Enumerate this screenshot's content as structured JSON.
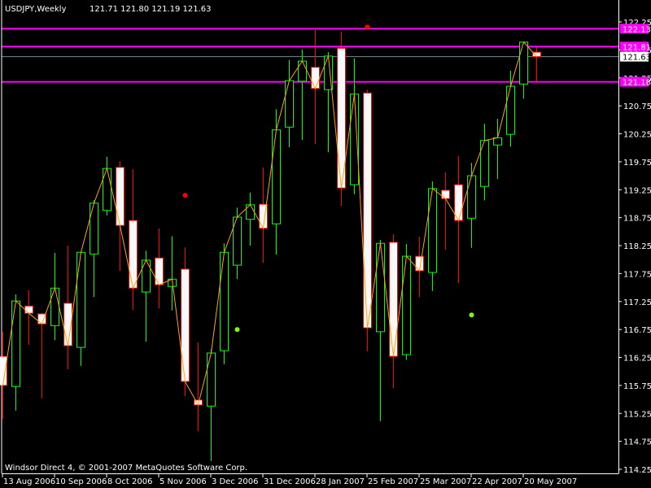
{
  "header": {
    "symbol_timeframe": "USDJPY,Weekly",
    "ohlc": "121.71 121.80 121.19 121.63"
  },
  "footer": {
    "copyright": "Windsor Direct 4, © 2001-2007 MetaQuotes Software Corp."
  },
  "colors": {
    "background": "#000000",
    "axis": "#ffffff",
    "bull_outline": "#00ff00",
    "bear_outline": "#ff0000",
    "bear_fill": "#f8f8f8",
    "close_line": "#ffa500",
    "level_line": "#ff00ff",
    "bid_line": "#778899",
    "marker_red": "#ff0000",
    "marker_green": "#7cfc00"
  },
  "chart_data": {
    "type": "candlestick",
    "title": "USDJPY,Weekly",
    "ylim": [
      114.25,
      122.25
    ],
    "y_ticks": [
      "122.25",
      "121.75",
      "121.25",
      "120.75",
      "120.25",
      "119.75",
      "119.25",
      "118.75",
      "118.25",
      "117.75",
      "117.25",
      "116.75",
      "116.25",
      "115.75",
      "115.25",
      "114.75",
      "114.25"
    ],
    "x_ticks": [
      {
        "index": 0,
        "label": "13 Aug 2006"
      },
      {
        "index": 4,
        "label": "10 Sep 2006"
      },
      {
        "index": 8,
        "label": "8 Oct 2006"
      },
      {
        "index": 12,
        "label": "5 Nov 2006"
      },
      {
        "index": 16,
        "label": "3 Dec 2006"
      },
      {
        "index": 20,
        "label": "31 Dec 2006"
      },
      {
        "index": 24,
        "label": "28 Jan 2007"
      },
      {
        "index": 28,
        "label": "25 Feb 2007"
      },
      {
        "index": 32,
        "label": "25 Mar 2007"
      },
      {
        "index": 36,
        "label": "22 Apr 2007"
      },
      {
        "index": 40,
        "label": "20 May 2007"
      }
    ],
    "candles": [
      [
        116.27,
        116.71,
        115.15,
        115.75
      ],
      [
        115.73,
        117.38,
        115.3,
        117.26
      ],
      [
        117.17,
        117.45,
        116.48,
        117.04
      ],
      [
        117.03,
        117.05,
        115.52,
        116.85
      ],
      [
        116.82,
        118.12,
        116.56,
        117.49
      ],
      [
        117.22,
        118.25,
        116.04,
        116.46
      ],
      [
        116.43,
        118.13,
        116.1,
        118.13
      ],
      [
        118.1,
        119.06,
        117.33,
        119.01
      ],
      [
        118.88,
        119.84,
        118.79,
        119.63
      ],
      [
        119.65,
        119.76,
        117.8,
        118.61
      ],
      [
        118.7,
        119.62,
        117.1,
        117.49
      ],
      [
        117.42,
        118.16,
        116.53,
        117.99
      ],
      [
        118.03,
        118.56,
        117.13,
        117.55
      ],
      [
        117.52,
        118.42,
        117.09,
        117.65
      ],
      [
        117.83,
        118.22,
        115.56,
        115.82
      ],
      [
        115.49,
        116.52,
        114.93,
        115.4
      ],
      [
        115.38,
        116.4,
        114.4,
        116.33
      ],
      [
        116.37,
        118.29,
        116.13,
        118.13
      ],
      [
        117.9,
        118.93,
        117.65,
        118.76
      ],
      [
        118.72,
        119.2,
        118.25,
        118.98
      ],
      [
        118.99,
        119.65,
        117.94,
        118.56
      ],
      [
        118.64,
        120.69,
        118.09,
        120.32
      ],
      [
        120.37,
        121.57,
        120.01,
        121.2
      ],
      [
        121.19,
        121.76,
        120.14,
        121.55
      ],
      [
        121.44,
        122.15,
        120.07,
        121.06
      ],
      [
        121.04,
        121.71,
        119.92,
        121.64
      ],
      [
        121.78,
        122.08,
        118.96,
        119.28
      ],
      [
        119.34,
        121.6,
        119.17,
        120.96
      ],
      [
        120.98,
        121.04,
        116.36,
        116.78
      ],
      [
        116.71,
        118.35,
        115.11,
        118.29
      ],
      [
        118.31,
        118.45,
        115.7,
        116.27
      ],
      [
        116.3,
        118.28,
        116.21,
        118.06
      ],
      [
        118.06,
        118.41,
        117.33,
        117.8
      ],
      [
        117.77,
        119.4,
        117.44,
        119.27
      ],
      [
        119.24,
        119.56,
        118.18,
        119.09
      ],
      [
        119.34,
        119.85,
        117.58,
        118.7
      ],
      [
        118.74,
        119.73,
        118.21,
        119.5
      ],
      [
        119.31,
        120.43,
        119.06,
        120.13
      ],
      [
        120.05,
        120.52,
        119.44,
        120.18
      ],
      [
        120.24,
        121.38,
        120.02,
        121.1
      ],
      [
        121.14,
        121.89,
        120.88,
        121.89
      ],
      [
        121.71,
        121.8,
        121.19,
        121.63
      ]
    ],
    "candle_fields": [
      "open",
      "high",
      "low",
      "close"
    ],
    "levels": [
      {
        "price": 122.13,
        "label": "122.13"
      },
      {
        "price": 121.81,
        "label": "121.81"
      },
      {
        "price": 121.18,
        "label": "121.18"
      }
    ],
    "bid": {
      "price": 121.63,
      "label": "121.63"
    },
    "markers": [
      {
        "index": 28,
        "price": 122.16,
        "color": "red"
      },
      {
        "index": 14,
        "price": 119.15,
        "color": "red"
      },
      {
        "index": 18,
        "price": 116.75,
        "color": "green"
      },
      {
        "index": 36,
        "price": 117.01,
        "color": "green"
      }
    ]
  }
}
